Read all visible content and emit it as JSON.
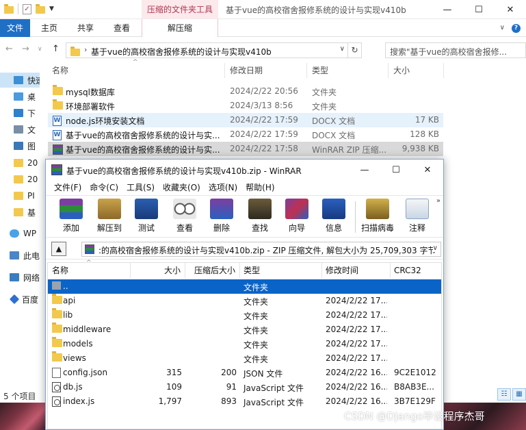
{
  "explorer": {
    "window_title": "基于vue的高校宿舍报修系统的设计与实现v410b",
    "context_tab": "压缩的文件夹工具",
    "ribbon_tabs": [
      "文件",
      "主页",
      "共享",
      "查看"
    ],
    "context_subtab": "解压缩",
    "window_controls": {
      "minimize": "—",
      "maximize": "☐",
      "close": "✕"
    },
    "address": {
      "path": "基于vue的高校宿舍报修系统的设计与实现v410b",
      "refresh": "↻"
    },
    "search": {
      "placeholder": "搜索\"基于vue的高校宿舍报修..."
    },
    "nav_pane": [
      {
        "label": "快速",
        "icon": "star-icon",
        "selected": true
      },
      {
        "label": "桌",
        "icon": "desktop-icon"
      },
      {
        "label": "下",
        "icon": "download-icon"
      },
      {
        "label": "文",
        "icon": "document-icon"
      },
      {
        "label": "图",
        "icon": "picture-icon"
      },
      {
        "label": "20",
        "icon": "folder-icon"
      },
      {
        "label": "20",
        "icon": "folder-icon"
      },
      {
        "label": "PI",
        "icon": "folder-icon"
      },
      {
        "label": "基",
        "icon": "folder-icon"
      },
      {
        "label": "WP",
        "icon": "cloud-icon"
      },
      {
        "label": "此电",
        "icon": "computer-icon"
      },
      {
        "label": "网络",
        "icon": "network-icon"
      },
      {
        "label": "百度",
        "icon": "baidu-icon"
      }
    ],
    "columns": {
      "name": "名称",
      "date": "修改日期",
      "type": "类型",
      "size": "大小"
    },
    "files": [
      {
        "name": "mysql数据库",
        "date": "2024/2/22 20:56",
        "type": "文件夹",
        "size": "",
        "icon": "folder-icon"
      },
      {
        "name": "环境部署软件",
        "date": "2024/3/13 8:56",
        "type": "文件夹",
        "size": "",
        "icon": "folder-icon"
      },
      {
        "name": "node.js环境安装文档",
        "date": "2024/2/22 17:59",
        "type": "DOCX 文档",
        "size": "17 KB",
        "icon": "word-doc-icon"
      },
      {
        "name": "基于vue的高校宿舍报修系统的设计与实...",
        "date": "2024/2/22 17:59",
        "type": "DOCX 文档",
        "size": "128 KB",
        "icon": "word-doc-icon"
      },
      {
        "name": "基于vue的高校宿舍报修系统的设计与实...",
        "date": "2024/2/22 17:58",
        "type": "WinRAR ZIP 压缩...",
        "size": "9,938 KB",
        "icon": "winrar-archive-icon"
      }
    ],
    "status": "5 个项目"
  },
  "winrar": {
    "title": "基于vue的高校宿舍报修系统的设计与实现v410b.zip - WinRAR",
    "window_controls": {
      "minimize": "—",
      "maximize": "☐",
      "close": "✕"
    },
    "menu": [
      "文件(F)",
      "命令(C)",
      "工具(S)",
      "收藏夹(O)",
      "选项(N)",
      "帮助(H)"
    ],
    "toolbar": [
      {
        "label": "添加",
        "name": "add"
      },
      {
        "label": "解压到",
        "name": "extract-to"
      },
      {
        "label": "测试",
        "name": "test"
      },
      {
        "label": "查看",
        "name": "view"
      },
      {
        "label": "删除",
        "name": "delete"
      },
      {
        "label": "查找",
        "name": "find"
      },
      {
        "label": "向导",
        "name": "wizard"
      },
      {
        "label": "信息",
        "name": "info"
      },
      {
        "label": "扫描病毒",
        "name": "scan-virus"
      },
      {
        "label": "注释",
        "name": "comment"
      }
    ],
    "toolbar_more": "»",
    "path": ":的高校宿舍报修系统的设计与实现v410b.zip - ZIP 压缩文件, 解包大小为 25,709,303 字节",
    "columns": {
      "name": "名称",
      "size": "大小",
      "packed": "压缩后大小",
      "type": "类型",
      "modified": "修改时间",
      "crc": "CRC32"
    },
    "entries": [
      {
        "name": "..",
        "size": "",
        "packed": "",
        "type": "文件夹",
        "modified": "",
        "crc": "",
        "icon": "parent-folder-icon"
      },
      {
        "name": "api",
        "size": "",
        "packed": "",
        "type": "文件夹",
        "modified": "2024/2/22 17...",
        "crc": "",
        "icon": "folder-icon"
      },
      {
        "name": "lib",
        "size": "",
        "packed": "",
        "type": "文件夹",
        "modified": "2024/2/22 17...",
        "crc": "",
        "icon": "folder-icon"
      },
      {
        "name": "middleware",
        "size": "",
        "packed": "",
        "type": "文件夹",
        "modified": "2024/2/22 17...",
        "crc": "",
        "icon": "folder-icon"
      },
      {
        "name": "models",
        "size": "",
        "packed": "",
        "type": "文件夹",
        "modified": "2024/2/22 17...",
        "crc": "",
        "icon": "folder-icon"
      },
      {
        "name": "views",
        "size": "",
        "packed": "",
        "type": "文件夹",
        "modified": "2024/2/22 17...",
        "crc": "",
        "icon": "folder-icon"
      },
      {
        "name": "config.json",
        "size": "315",
        "packed": "200",
        "type": "JSON 文件",
        "modified": "2024/2/22 16...",
        "crc": "9C2E1012",
        "icon": "json-file-icon"
      },
      {
        "name": "db.js",
        "size": "109",
        "packed": "91",
        "type": "JavaScript 文件",
        "modified": "2024/2/22 16...",
        "crc": "B8AB3E...",
        "icon": "js-file-icon"
      },
      {
        "name": "index.js",
        "size": "1,797",
        "packed": "893",
        "type": "JavaScript 文件",
        "modified": "2024/2/22 16...",
        "crc": "3B7E129F",
        "icon": "js-file-icon"
      }
    ]
  },
  "watermark": "CSDN @Django毕设程序杰哥",
  "colors": {
    "accent": "#1f6fc5",
    "context_tab": "#b0364f",
    "selection": "#0a64c8"
  }
}
